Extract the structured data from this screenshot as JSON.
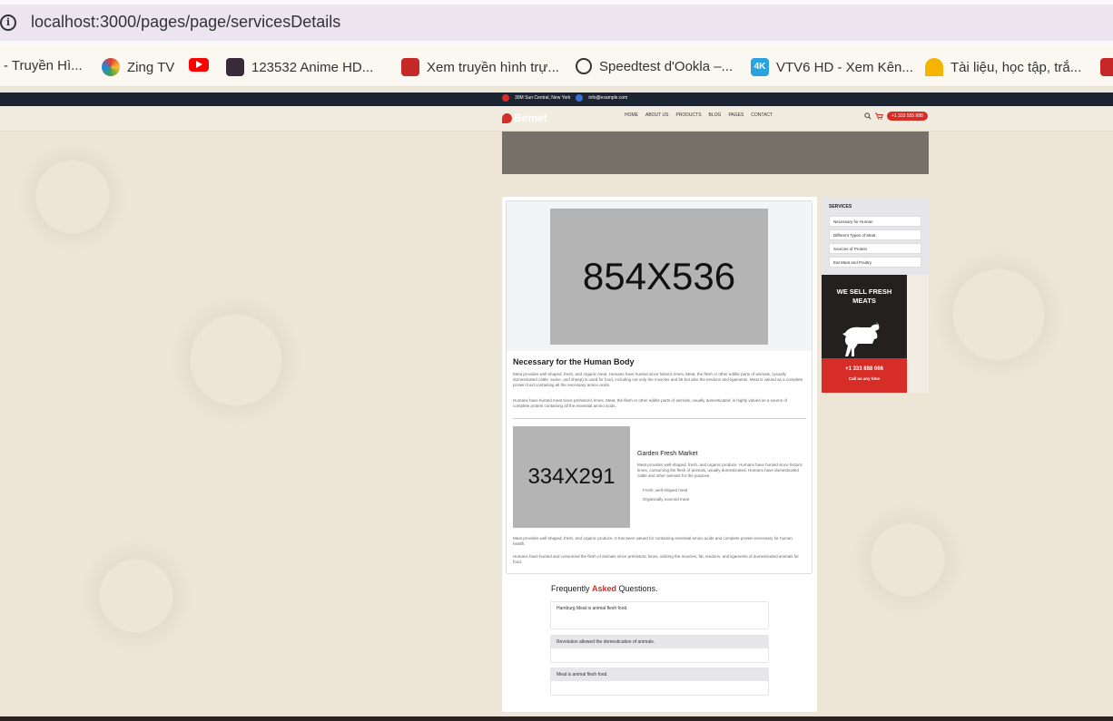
{
  "browser": {
    "url": "localhost:3000/pages/page/servicesDetails",
    "bookmarks": [
      {
        "label": "- Truyền Hì...",
        "icon": "tv-icon"
      },
      {
        "label": "Zing TV",
        "icon": "zing-icon"
      },
      {
        "label": "",
        "icon": "youtube-icon"
      },
      {
        "label": "123532 Anime HD...",
        "icon": "anime-icon"
      },
      {
        "label": "Xem truyền hình trự...",
        "icon": "tv-icon"
      },
      {
        "label": "Speedtest d'Ookla –...",
        "icon": "speedtest-icon"
      },
      {
        "label": "VTV6 HD - Xem Kên...",
        "icon": "4k-icon"
      },
      {
        "label": "Tài liệu, học tập, trắ...",
        "icon": "study-icon"
      }
    ]
  },
  "site": {
    "topbar": {
      "address": "30M Sun Central, New York",
      "email": "info@example.com"
    },
    "logo": "Bemet",
    "nav": [
      "HOME",
      "ABOUT US",
      "PRODUCTS",
      "BLOG",
      "PAGES",
      "CONTACT"
    ],
    "phone_pill": "+1 333 555 888"
  },
  "main": {
    "large_placeholder": "854X536",
    "title": "Necessary for the Human Body",
    "para1": "Meat provides well-shaped, fresh, and organic meat. Humans have hunted since historic times. Meat, the flesh or other edible parts of animals, (usually domesticated cattle, swine, and sheep) is used for food, including not only the muscles and fat but also the tendons and ligaments. Meat is valued as a complete protein food containing all the necessary amino acids.",
    "para2": "Humans have hunted meat since prehistoric times. Meat, the flesh or other edible parts of animals, usually domesticated, is highly valued as a source of complete protein containing all the essential amino acids.",
    "small_placeholder": "334X291",
    "sub_title": "Garden Fresh Market",
    "sub_para": "Meat provides well-shaped, fresh, and organic produce. Humans have hunted since historic times, consuming the flesh of animals, usually domesticated. Humans have domesticated cattle and other animals for the purpose.",
    "bullets": [
      "Fresh, well-shaped meat",
      "Organically sourced meat"
    ],
    "para3": "Meat provides well-shaped, fresh, and organic produce. It has been valued for containing essential amino acids and complete protein necessary for human health.",
    "para4": "Humans have hunted and consumed the flesh of animals since prehistoric times, utilizing the muscles, fat, tendons, and ligaments of domesticated animals for food."
  },
  "faq": {
    "title_pre": "Frequently ",
    "title_red": "Asked",
    "title_post": " Questions.",
    "items": [
      "Hamburg Meat is animal flesh food.",
      "Revolution allowed the domestication of animals.",
      "Meat is animal flesh food."
    ]
  },
  "sidebar": {
    "title": "SERVICES",
    "items": [
      "Necessary for Human",
      "Different Types of Meat",
      "Sources of Protein",
      "Eat Meat and Poultry"
    ]
  },
  "promo": {
    "title_line1": "WE SELL FRESH",
    "title_line2": "MEATS",
    "phone": "+1 333 888 666",
    "call": "Call us any time"
  },
  "colors": {
    "accent": "#d62d26",
    "topbar": "#1e2532",
    "background": "#ede5d6"
  }
}
